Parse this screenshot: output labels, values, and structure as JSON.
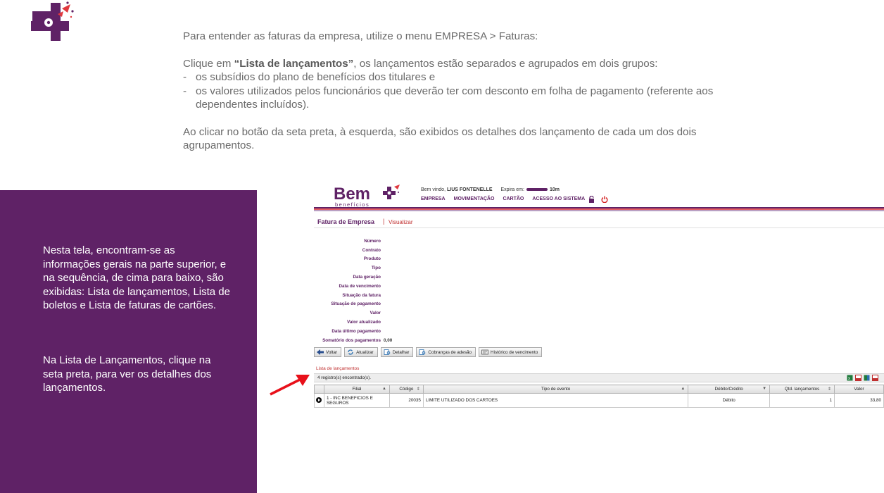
{
  "intro": {
    "line1": "Para entender as faturas da empresa, utilize o menu EMPRESA > Faturas:",
    "para2_prefix": "Clique em ",
    "para2_bold": "“Lista de lançamentos”",
    "para2_suffix": ", os lançamentos estão separados e agrupados em dois grupos:",
    "bullets": [
      "os subsídios do plano de benefícios dos titulares e",
      "os valores utilizados pelos funcionários que deverão ter com desconto em folha de pagamento (referente aos dependentes incluídos)."
    ],
    "para3": "Ao clicar no botão da seta preta, à esquerda, são exibidos os detalhes dos lançamento de cada um dos dois agrupamentos."
  },
  "side_panel": {
    "para1": "Nesta tela, encontram-se as informações gerais na parte superior, e na sequência, de cima para baixo, são exibidas: Lista de lançamentos, Lista de boletos e Lista de faturas de cartões.",
    "para2": "Na Lista de Lançamentos, clique na seta preta, para ver os detalhes dos lançamentos."
  },
  "app": {
    "logo_text": "Bem",
    "logo_sub": "benefícios",
    "welcome_prefix": "Bem vindo, ",
    "user_name": "LIUS FONTENELLE",
    "expire_label": "Expira em:",
    "expire_value": "10m",
    "nav": [
      "EMPRESA",
      "MOVIMENTAÇÃO",
      "CARTÃO",
      "ACESSO AO SISTEMA"
    ],
    "page_title": "Fatura de Empresa",
    "page_separator": "|",
    "page_subtitle": "Visualizar",
    "fields": [
      {
        "label": "Número",
        "value": ""
      },
      {
        "label": "Contrato",
        "value": ""
      },
      {
        "label": "Produto",
        "value": ""
      },
      {
        "label": "Tipo",
        "value": ""
      },
      {
        "label": "Data geração",
        "value": ""
      },
      {
        "label": "Data de vencimento",
        "value": ""
      },
      {
        "label": "Situação da fatura",
        "value": ""
      },
      {
        "label": "Situação de pagamento",
        "value": ""
      },
      {
        "label": "Valor",
        "value": ""
      },
      {
        "label": "Valor atualizado",
        "value": ""
      },
      {
        "label": "Data último pagamento",
        "value": ""
      },
      {
        "label": "Somatório dos pagamentos",
        "value": "0,00"
      }
    ],
    "buttons": {
      "back": "Voltar",
      "refresh": "Atualizar",
      "detail": "Detalhar",
      "charges": "Cobranças de adesão",
      "history": "Histórico de vencimento"
    },
    "list_title": "Lista de lançamentos",
    "list_count": "4 registro(s) encontrado(s).",
    "table": {
      "headers": [
        "Filial",
        "Código",
        "Tipo de evento",
        "Débito/Crédito",
        "Qtd. lançamentos",
        "Valor"
      ],
      "rows": [
        {
          "filial": "1 - INC BENEFICIOS E SEGUROS",
          "codigo": "20035",
          "tipo": "LIMITE UTILIZADO DOS CARTOES",
          "debito_credito": "Débito",
          "qtd": "1",
          "valor": "33,80"
        }
      ]
    }
  },
  "colors": {
    "brand_purple": "#5f2266",
    "accent_red": "#d42020",
    "arrow_red": "#e8101a"
  }
}
